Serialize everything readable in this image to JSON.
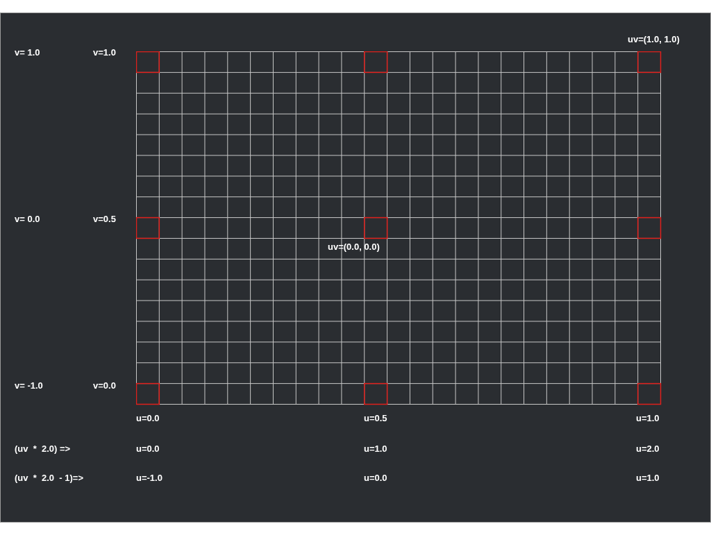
{
  "diagram": {
    "labels": [
      {
        "text": "uv=(1.0, 1.0)"
      },
      {
        "text": "v= 1.0"
      },
      {
        "text": "v=1.0"
      },
      {
        "text": "v= 0.0"
      },
      {
        "text": "v=0.5"
      },
      {
        "text": "uv=(0.0, 0.0)"
      },
      {
        "text": "v= -1.0"
      },
      {
        "text": "v=0.0"
      },
      {
        "text": "u=0.0"
      },
      {
        "text": "u=0.5"
      },
      {
        "text": "u=1.0"
      },
      {
        "text": "(uv  *  2.0) =>"
      },
      {
        "text": "u=0.0"
      },
      {
        "text": "u=1.0"
      },
      {
        "text": "u=2.0"
      },
      {
        "text": "(uv  *  2.0  - 1)=>"
      },
      {
        "text": "u=-1.0"
      },
      {
        "text": "u=0.0"
      },
      {
        "text": "u=1.0"
      }
    ]
  }
}
